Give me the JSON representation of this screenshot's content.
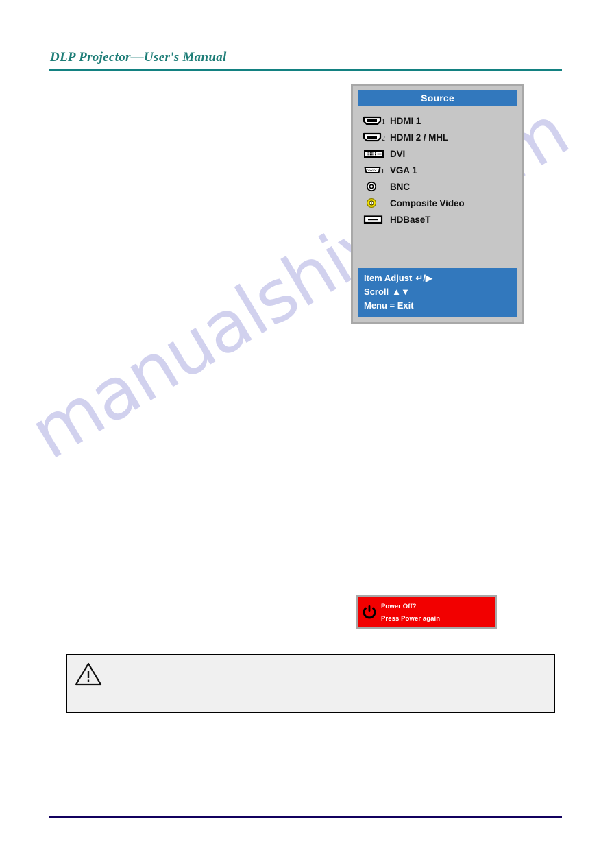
{
  "header": {
    "title": "DLP Projector—User's Manual",
    "rule_color": "#138181",
    "title_color": "#1d7d77"
  },
  "watermark": {
    "text": "manualshive.com",
    "color": "#c9c9ec"
  },
  "osd": {
    "title": "Source",
    "accent_color": "#3278bd",
    "body_color": "#c6c6c6",
    "border_color": "#a8a8a8",
    "items": [
      {
        "label": "HDMI 1",
        "icon": "hdmi-connector-icon",
        "badge": "1"
      },
      {
        "label": "HDMI 2 / MHL",
        "icon": "hdmi-connector-icon",
        "badge": "2"
      },
      {
        "label": "DVI",
        "icon": "dvi-connector-icon",
        "badge": ""
      },
      {
        "label": "VGA 1",
        "icon": "vga-dsub-connector-icon",
        "badge": "1"
      },
      {
        "label": "BNC",
        "icon": "bnc-connector-icon",
        "badge": ""
      },
      {
        "label": "Composite Video",
        "icon": "composite-rca-connector-icon",
        "badge": ""
      },
      {
        "label": "HDBaseT",
        "icon": "hdbaset-connector-icon",
        "badge": ""
      }
    ],
    "footer": [
      {
        "label": "Item Adjust",
        "glyphs": "↵/▶"
      },
      {
        "label": "Scroll",
        "glyphs": "▲▼"
      },
      {
        "label": "Menu = Exit",
        "glyphs": ""
      }
    ]
  },
  "power_dialog": {
    "line1": "Power Off?",
    "line2": "Press Power again",
    "background_color": "#f20000",
    "border_color": "#a8a8a8",
    "icon": "power-symbol-icon"
  },
  "caution": {
    "icon": "warning-triangle-icon",
    "text": ""
  },
  "footer": {
    "rule_color": "#11005e"
  }
}
